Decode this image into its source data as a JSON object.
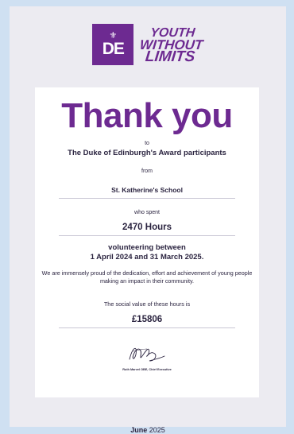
{
  "branding": {
    "badge_mark": "DE",
    "slogan": [
      "YOUTH",
      "WITHOUT",
      "LIMITS"
    ],
    "brand_color": "#6d2a91"
  },
  "certificate": {
    "title": "Thank you",
    "to_label": "to",
    "recipients": "The Duke of Edinburgh's Award participants",
    "from_label": "from",
    "school": "St. Katherine's School",
    "who_spent_label": "who spent",
    "hours": "2470 Hours",
    "volunteering_line1": "volunteering between",
    "volunteering_line2": "1 April 2024 and 31 March 2025.",
    "message": "We are immensely proud of the dedication, effort and achievement of young people making an impact in their community.",
    "social_value_label": "The social value of these hours is",
    "social_value": "£15806",
    "signatory": "Ruth Marvel OBE, Chief Executive"
  },
  "footer": {
    "month": "June",
    "year": "2025"
  }
}
